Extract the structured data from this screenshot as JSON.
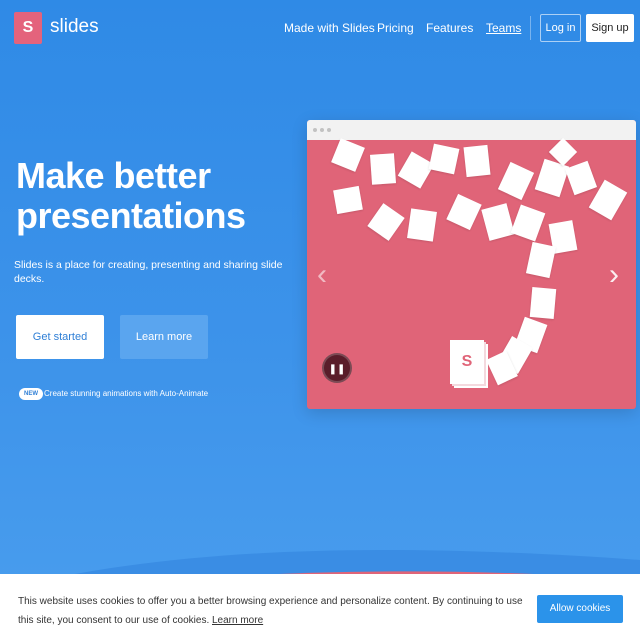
{
  "brand": {
    "logo_letter": "S",
    "name": "slides"
  },
  "nav": {
    "links": [
      "Made with Slides",
      "Pricing",
      "Features",
      "Teams"
    ],
    "login": "Log in",
    "signup": "Sign up"
  },
  "hero": {
    "title_line1": "Make better",
    "title_line2": "presentations",
    "subtitle": "Slides is a place for creating, presenting and sharing slide decks.",
    "primary_button": "Get started",
    "secondary_button": "Learn more",
    "badge": "NEW",
    "announcement": "Create stunning animations with Auto-Animate"
  },
  "demo": {
    "card_letter": "S",
    "prev_icon": "chevron-left-icon",
    "next_icon": "chevron-right-icon",
    "pause_icon": "pause-icon"
  },
  "cookies": {
    "text": "This website uses cookies to offer you a better browsing experience and personalize content. By continuing to use this site, you consent to our use of cookies.",
    "learn_more": "Learn more",
    "allow": "Allow cookies"
  },
  "colors": {
    "background": "#2f8ae6",
    "accent_pink": "#e06478",
    "cookie_button": "#2b93ea"
  }
}
